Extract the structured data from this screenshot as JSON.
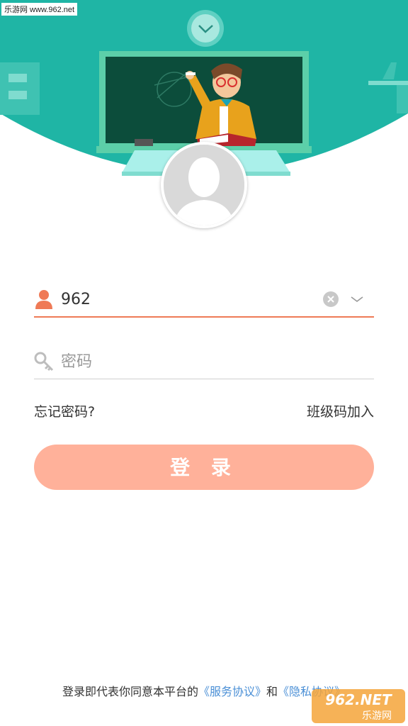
{
  "watermark": {
    "top": "乐游网 www.962.net",
    "bottom_brand": "962.NET",
    "bottom_sub": "乐游网"
  },
  "login": {
    "username_value": "962",
    "password_placeholder": "密码",
    "forgot_password": "忘记密码?",
    "join_class": "班级码加入",
    "login_button": "登 录"
  },
  "agreement": {
    "prefix": "登录即代表你同意本平台的",
    "service_link": "《服务协议》",
    "and": "和",
    "privacy_link": "《隐私协议》"
  },
  "colors": {
    "header_teal": "#1fb5a5",
    "accent_orange": "#ef7a56",
    "button": "#ffb19a",
    "link": "#4a8fd6"
  }
}
